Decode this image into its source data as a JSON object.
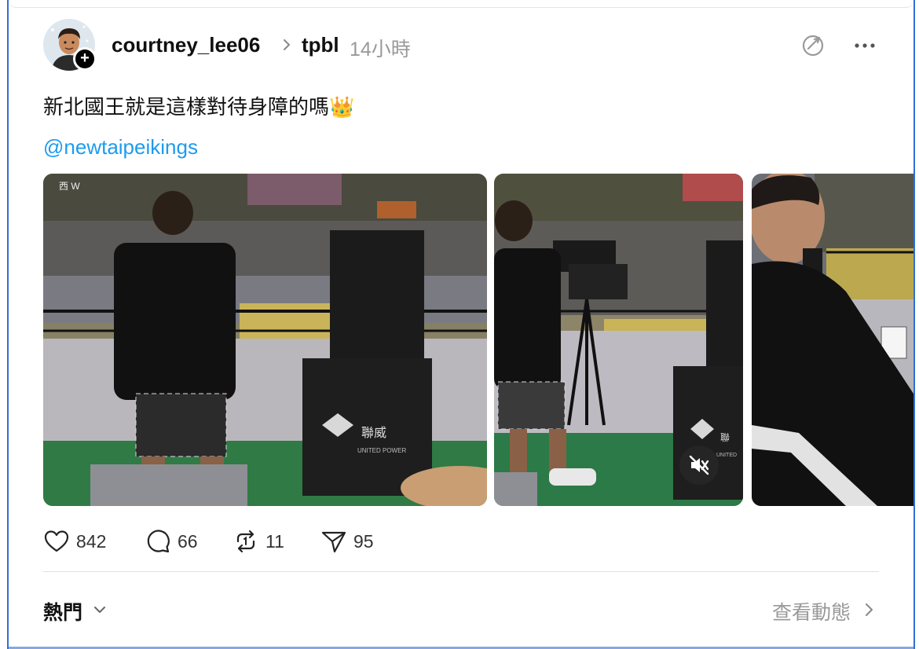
{
  "post": {
    "username": "courtney_lee06",
    "community": "tpbl",
    "timestamp": "14小時",
    "text": "新北國王就是這樣對待身障的嗎👑",
    "mention": "@newtaipeikings"
  },
  "media": {
    "image1": {
      "sign_cn": "聯威",
      "sign_en": "UNITED POWER",
      "scoreboard": "西 W"
    },
    "image2": {
      "sign_cn": "聯",
      "sign_en": "UNITED",
      "muted": true
    }
  },
  "actions": {
    "likes": "842",
    "replies": "66",
    "reposts": "11",
    "shares": "95"
  },
  "footer": {
    "sort_label": "熱門",
    "activity_label": "查看動態"
  },
  "colors": {
    "accent_link": "#1d9bf0",
    "muted_text": "#999999",
    "frame": "#2f6fd6"
  },
  "icons": [
    "plus-icon",
    "chevron-right-icon",
    "translate-icon",
    "more-icon",
    "mute-icon",
    "heart-icon",
    "reply-icon",
    "repost-icon",
    "share-icon",
    "chevron-down-icon"
  ]
}
